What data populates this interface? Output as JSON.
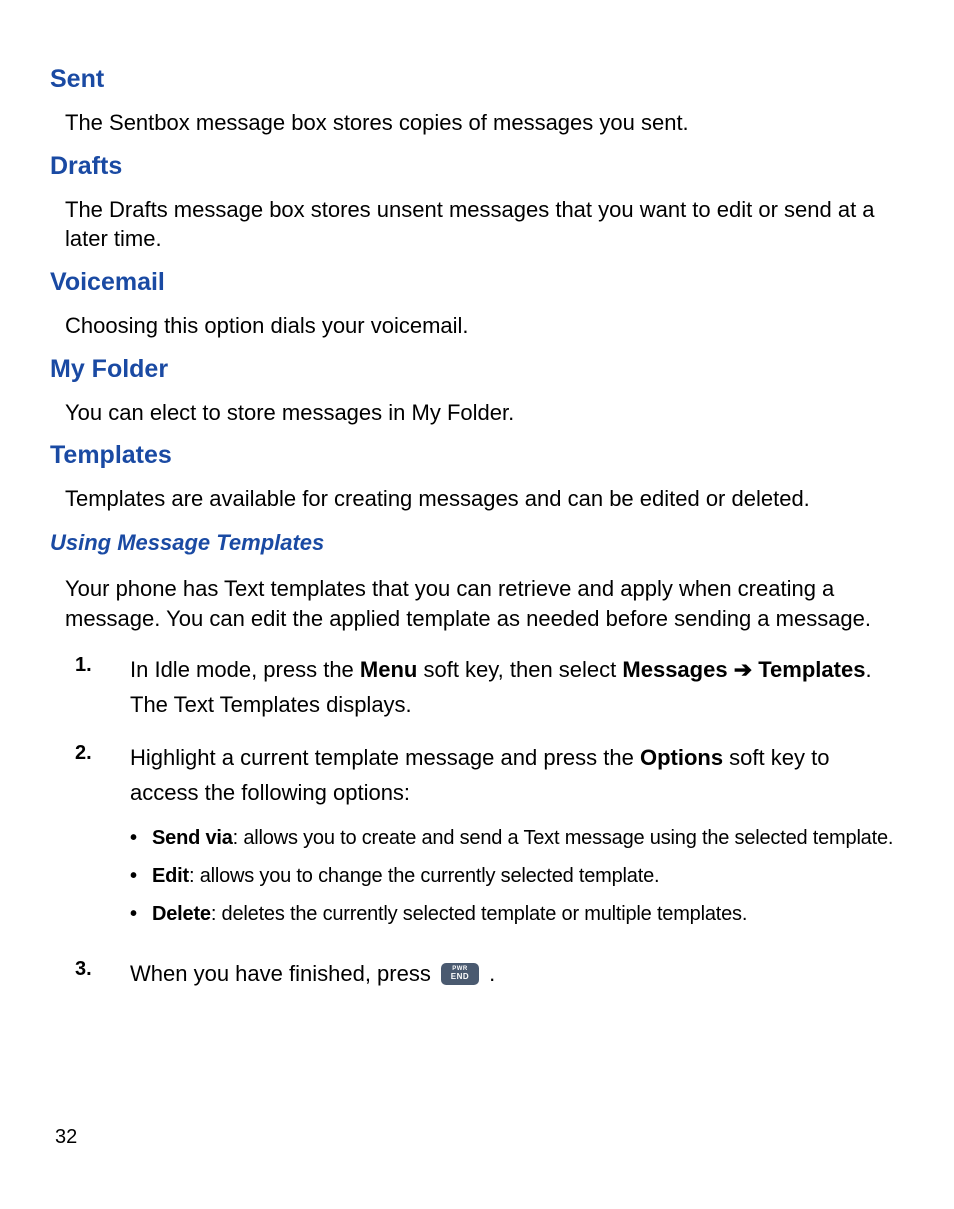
{
  "sections": {
    "sent": {
      "heading": "Sent",
      "body": "The Sentbox message box stores copies of messages you sent."
    },
    "drafts": {
      "heading": "Drafts",
      "body": "The Drafts message box stores unsent messages that you want to edit or send at a later time."
    },
    "voicemail": {
      "heading": "Voicemail",
      "body": "Choosing this option dials your voicemail."
    },
    "myfolder": {
      "heading": "My Folder",
      "body": "You can elect to store messages in My Folder."
    },
    "templates": {
      "heading": "Templates",
      "body": "Templates are available for creating messages and can be edited or deleted."
    }
  },
  "subsection": {
    "heading": "Using Message Templates",
    "intro": "Your phone has Text templates that you can retrieve and apply when creating a message. You can edit the applied template as needed before sending a message."
  },
  "steps": {
    "n1": "1.",
    "s1_a": "In Idle mode, press the ",
    "s1_menu": "Menu",
    "s1_b": " soft key, then select ",
    "s1_messages": "Messages",
    "s1_arrow": " ➔ ",
    "s1_templates": "Templates",
    "s1_c": ". The Text Templates displays.",
    "n2": "2.",
    "s2_a": "Highlight a current template message and press the ",
    "s2_options": "Options",
    "s2_b": " soft key to access the following options:",
    "bullets": {
      "b1_label": "Send via",
      "b1_text": ": allows you to create and send a Text message using the selected template.",
      "b2_label": "Edit",
      "b2_text": ": allows you to change the currently selected template.",
      "b3_label": "Delete",
      "b3_text": ": deletes the currently selected template or multiple templates."
    },
    "n3": "3.",
    "s3_a": "When you have finished, press ",
    "s3_b": " .",
    "key_l1": "PWR",
    "key_l2": "END"
  },
  "page_number": "32"
}
